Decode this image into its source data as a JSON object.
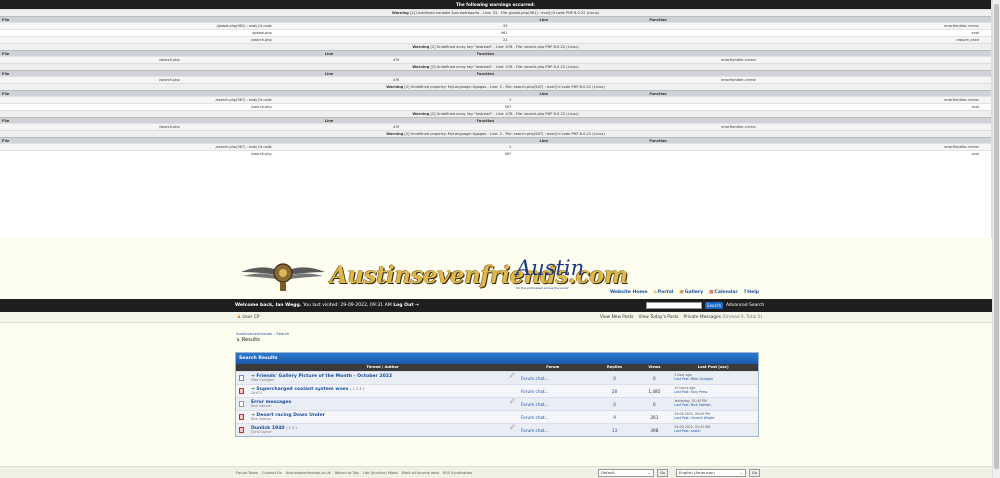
{
  "warnings": {
    "title": "The following warnings occurred:",
    "w1": {
      "label": "Warning",
      "text": " [2] Undefined variable $unreadreports - Line: 33 - File: global.php(961) : eval()'d code PHP 8.0.22 (Linux)"
    },
    "w2": {
      "label": "Warning",
      "text": " [2] Undefined array key \"lastread\" - Line: 476 - File: search.php PHP 8.0.22 (Linux)"
    },
    "w3": {
      "label": "Warning",
      "text": " [2] Undefined array key \"lastread\" - Line: 476 - File: search.php PHP 8.0.22 (Linux)"
    },
    "w4": {
      "label": "Warning",
      "text": " [2] Undefined property: MyLanguage::$gogos - Line: 2 - File: search.php(567) : eval()'d code PHP 8.0.22 (Linux)"
    },
    "w5": {
      "label": "Warning",
      "text": " [2] Undefined array key \"lastread\" - Line: 476 - File: search.php PHP 8.0.22 (Linux)"
    },
    "w6": {
      "label": "Warning",
      "text": " [2] Undefined property: MyLanguage::$gogos - Line: 2 - File: search.php(567) : eval()'d code PHP 8.0.22 (Linux)"
    },
    "head": {
      "file": "File",
      "line": "Line",
      "function": "Function"
    },
    "t1": [
      {
        "file": "/global.php(961) : eval()'d code",
        "line": "33",
        "func": "errorHandler->error"
      },
      {
        "file": "/global.php",
        "line": "961",
        "func": "eval"
      },
      {
        "file": "/search.php",
        "line": "22",
        "func": "require_once"
      }
    ],
    "t2": [
      {
        "file": "/search.php",
        "line": "476",
        "func": "errorHandler->error"
      }
    ],
    "t3": [
      {
        "file": "/search.php",
        "line": "476",
        "func": "errorHandler->error"
      }
    ],
    "t4": [
      {
        "file": "/search.php(567) : eval()'d code",
        "line": "2",
        "func": "errorHandler->error"
      },
      {
        "file": "/search.php",
        "line": "567",
        "func": "eval"
      }
    ],
    "t5": [
      {
        "file": "/search.php",
        "line": "476",
        "func": "errorHandler->error"
      }
    ],
    "t6": [
      {
        "file": "/search.php(567) : eval()'d code",
        "line": "2",
        "func": "errorHandler->error"
      },
      {
        "file": "/search.php",
        "line": "567",
        "func": "eval"
      }
    ]
  },
  "banner": {
    "site_name": "Austinsevenfriends.com",
    "austin": "Austin",
    "austin_sub": "for the enthusiast across the world"
  },
  "topnav": {
    "home": "Website Home",
    "portal": "Portal",
    "gallery": "Gallery",
    "calendar": "Calendar",
    "help": "Help"
  },
  "welcome": {
    "greeting": "Welcome back, Ian Wegg.",
    "visited": " You last visited: 29-09-2022, 09:31 AM ",
    "logout": "Log Out",
    "search_btn": "Search",
    "advanced": "Advanced Search"
  },
  "ucp": {
    "user_cp": "User CP",
    "new_posts": "View New Posts",
    "todays_posts": "View Today's Posts",
    "pm": "Private Messages",
    "pm_count": "(Unread 0, Total 0)"
  },
  "breadcrumb": {
    "site": "Austinsevenfriends",
    "sep": " › ",
    "search": "Search"
  },
  "page_title": "Results",
  "results": {
    "title": "Search Results",
    "columns": {
      "thread": "Thread / Author",
      "forum": "Forum",
      "replies": "Replies",
      "views": "Views",
      "lastpost": "Last Post [asc]"
    },
    "rows": [
      {
        "title": "Friends' Gallery Picture of the Month - October 2022",
        "pages": "",
        "author": "Mike Costigan",
        "forum": "Forum chat...",
        "replies": "0",
        "views": "0",
        "last_time": "1 hour ago",
        "last_by": "Last Post: Mike Costigan",
        "arrow": "➔",
        "clip": "🖉",
        "icon": "normal"
      },
      {
        "title": "Supercharged coolant system woes",
        "pages": "( 1 2 3 )",
        "author": "Dirk73",
        "forum": "Forum chat...",
        "replies": "28",
        "views": "1,485",
        "last_time": "10 hours ago",
        "last_by": "Last Post: Tony Press",
        "arrow": "➔",
        "clip": "",
        "icon": "hot"
      },
      {
        "title": "Error messages",
        "pages": "",
        "author": "Nick Salmon",
        "forum": "Forum chat...",
        "replies": "0",
        "views": "0",
        "last_time": "Yesterday, 01:45 PM",
        "last_by": "Last Post: Nick Salmon",
        "arrow": "",
        "clip": "🖉",
        "icon": "none"
      },
      {
        "title": "Desert racing Down Under",
        "pages": "",
        "author": "Nick Salmon",
        "forum": "Forum chat...",
        "replies": "9",
        "views": "261",
        "last_time": "29-09-2022, 09:09 PM",
        "last_by": "Last Post: Vincent Wright",
        "arrow": "➔",
        "clip": "",
        "icon": "hot"
      },
      {
        "title": "Dunlick 1940",
        "pages": "( 1 2 )",
        "author": "Chris Garner",
        "forum": "Forum chat...",
        "replies": "13",
        "views": "398",
        "last_time": "29-09-2022, 05:43 AM",
        "last_by": "Last Post: austin",
        "arrow": "",
        "clip": "🖉",
        "icon": "hot"
      }
    ]
  },
  "footer": {
    "links": [
      "Forum Team",
      "Contact Us",
      "Austinsevenfriends.co.uk",
      "Return to Top",
      "Lite (Archive) Mode",
      "Mark all forums read",
      "RSS Syndication"
    ],
    "theme": "Default",
    "language": "English (American)",
    "go": "Go"
  }
}
